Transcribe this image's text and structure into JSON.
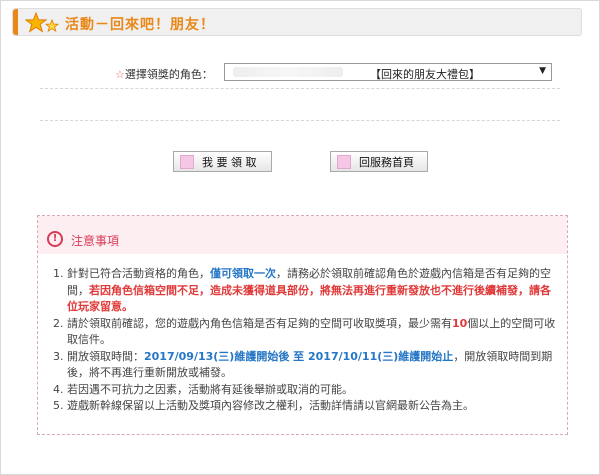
{
  "header": {
    "title": "活動－回來吧！朋友！"
  },
  "form": {
    "label_mark": "☆",
    "label": "選擇領獎的角色：",
    "selected_value": "【回來的朋友大禮包】"
  },
  "buttons": {
    "claim": "我 要 領 取",
    "home": "回服務首頁"
  },
  "notice": {
    "title": "注意事項",
    "items": [
      {
        "p1": "針對已符合活動資格的角色，",
        "h1": "僅可領取一次",
        "p2": "，請務必於領取前確認角色於遊戲內信箱是否有足夠的空間，",
        "h2": "若因角色信箱空間不足，造成未獲得道具部份，將無法再進行重新發放也不進行後續補發，請各位玩家留意。"
      },
      {
        "p1": "請於領取前確認，您的遊戲內角色信箱是否有足夠的空間可收取獎項，最少需有",
        "h1": "10",
        "p2": "個以上的空間可收取信件。"
      },
      {
        "p1": "開放領取時間：",
        "h1": "2017/09/13(三)維護開始後 至 2017/10/11(三)維護開始止",
        "p2": "，開放領取時間到期後，將不再進行重新開放或補發。"
      },
      {
        "p1": "若因遇不可抗力之因素，活動將有延後舉辦或取消的可能。"
      },
      {
        "p1": "遊戲新幹線保留以上活動及獎項內容修改之權利，活動詳情請以官網最新公告為主。"
      }
    ]
  }
}
